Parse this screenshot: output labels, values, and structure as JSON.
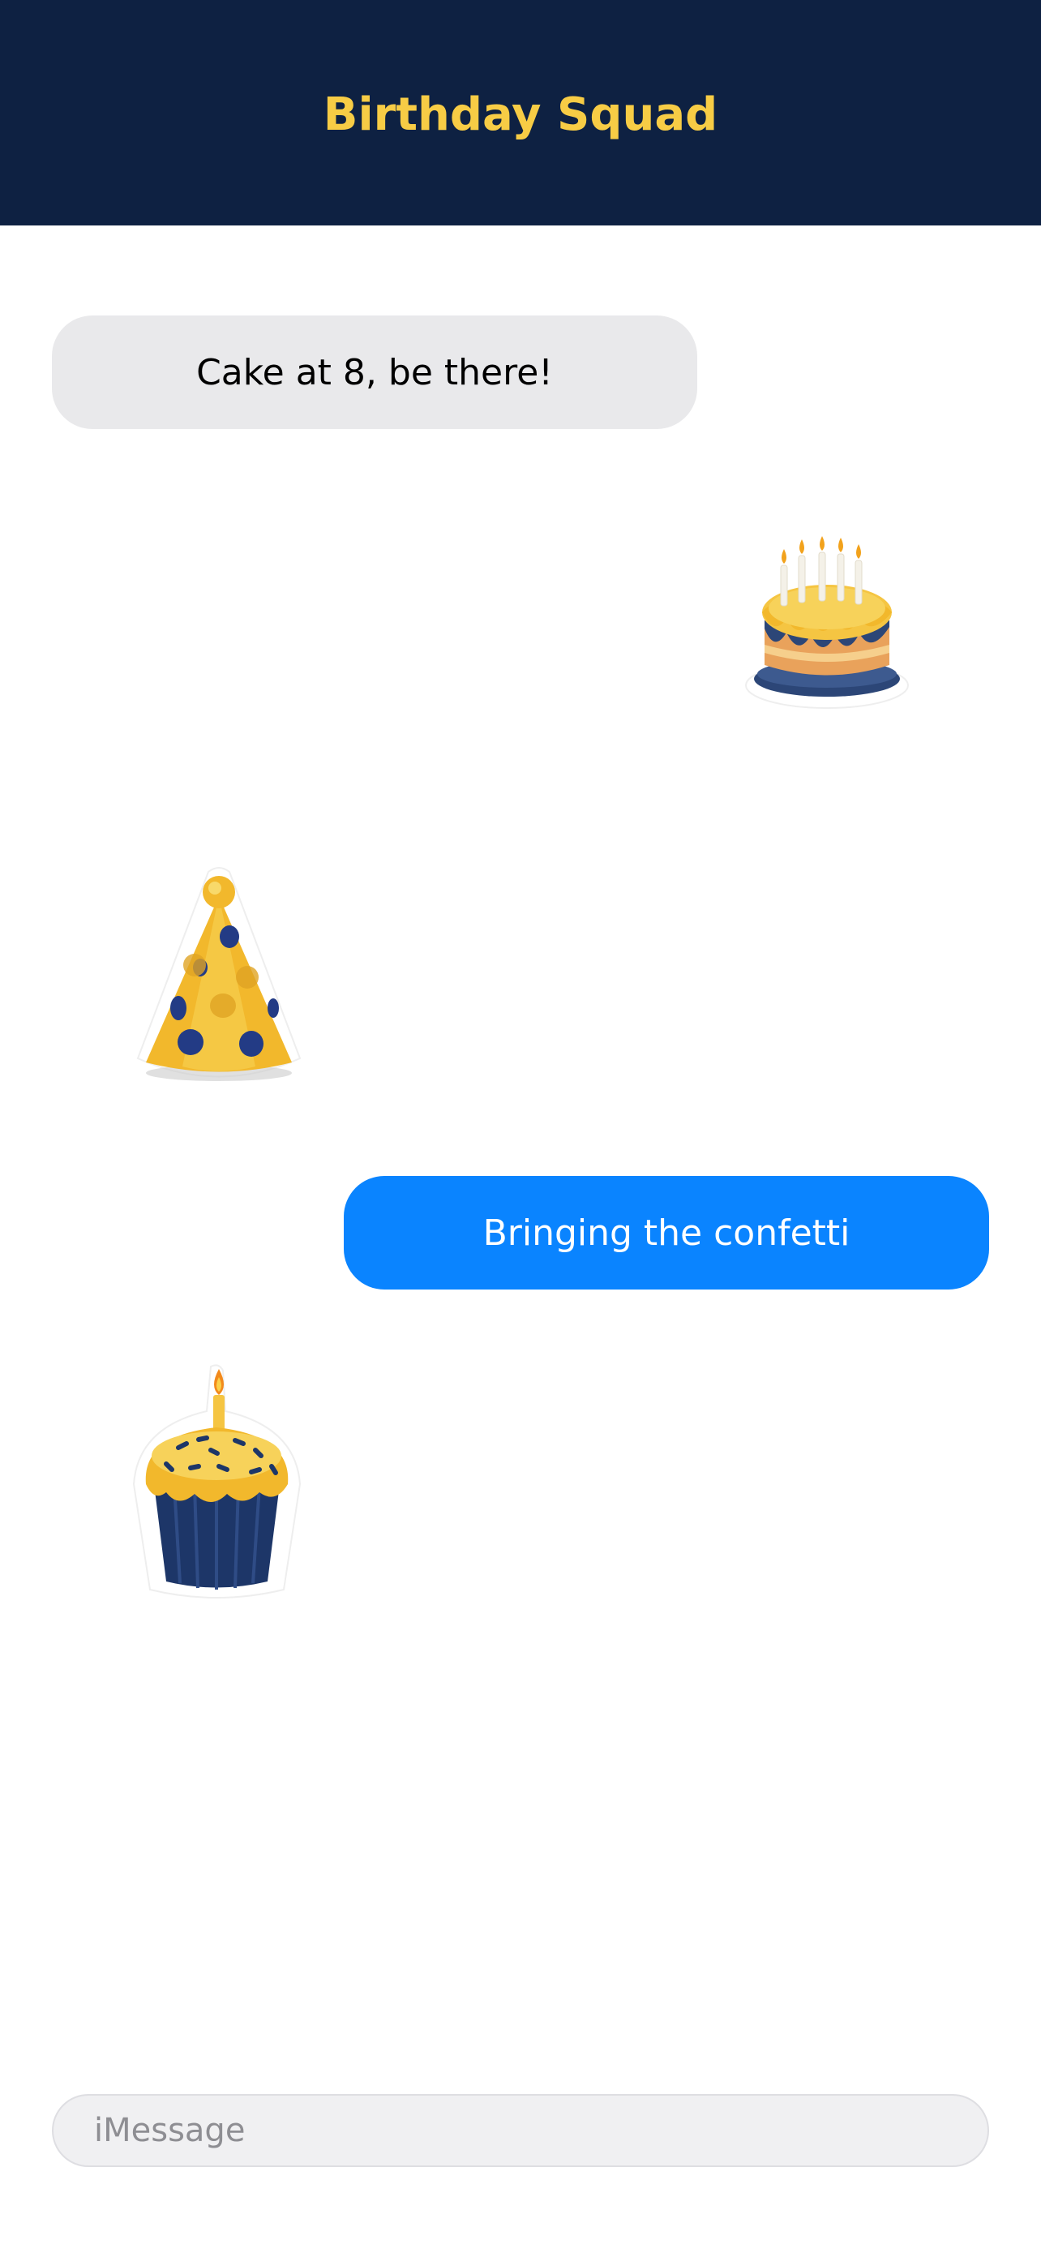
{
  "header": {
    "title": "Birthday Squad"
  },
  "messages": [
    {
      "direction": "incoming",
      "type": "text",
      "text": "Cake at 8, be there!"
    },
    {
      "direction": "outgoing",
      "type": "sticker",
      "icon": "birthday-cake-icon"
    },
    {
      "direction": "incoming",
      "type": "sticker",
      "icon": "party-hat-icon"
    },
    {
      "direction": "outgoing",
      "type": "text",
      "text": "Bringing the confetti"
    },
    {
      "direction": "incoming",
      "type": "sticker",
      "icon": "cupcake-icon"
    }
  ],
  "composer": {
    "placeholder": "iMessage"
  },
  "colors": {
    "header_bg": "#0e2142",
    "title": "#f7cc45",
    "incoming_bubble": "#e9e9eb",
    "outgoing_bubble": "#0a84ff"
  }
}
